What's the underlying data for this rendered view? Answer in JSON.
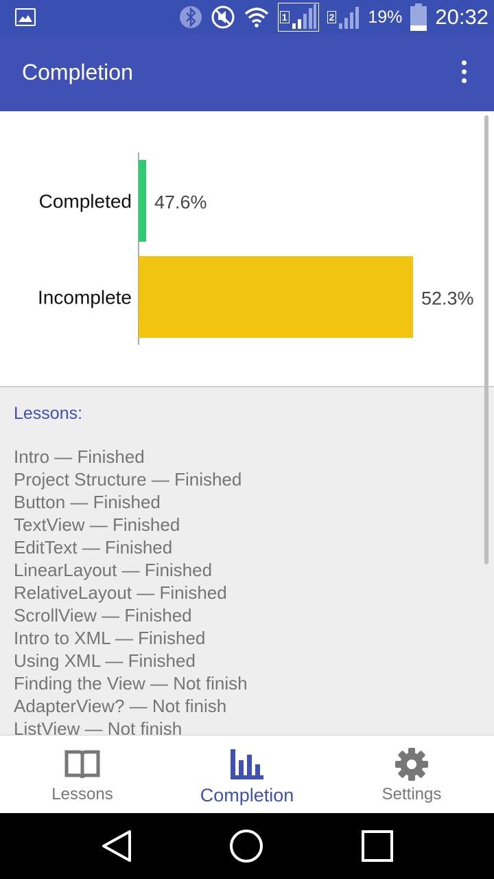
{
  "status_bar": {
    "battery": "19%",
    "time": "20:32",
    "sim1": "1",
    "sim2": "2",
    "icons": [
      "image-icon",
      "bluetooth-icon",
      "mute-icon",
      "wifi-icon",
      "signal-sim1-icon",
      "signal-sim2-icon",
      "battery-icon"
    ]
  },
  "app_bar": {
    "title": "Completion",
    "menu_icon": "more-vert-icon"
  },
  "chart_data": {
    "type": "bar",
    "orientation": "horizontal",
    "categories": [
      "Completed",
      "Incomplete"
    ],
    "values": [
      47.6,
      52.3
    ],
    "value_labels": [
      "47.6%",
      "52.3%"
    ],
    "colors": [
      "#2ecc71",
      "#f1c40f"
    ],
    "title": "",
    "xlabel": "",
    "ylabel": "",
    "grid": false,
    "legend": false
  },
  "lessons": {
    "heading": "Lessons:",
    "items": [
      "Intro — Finished",
      "Project Structure — Finished",
      "Button — Finished",
      "TextView — Finished",
      "EditText — Finished",
      "LinearLayout — Finished",
      "RelativeLayout — Finished",
      "ScrollView — Finished",
      "Intro to XML — Finished",
      "Using XML — Finished",
      "Finding the View — Not finish",
      "AdapterView? — Not finish",
      "ListView — Not finish"
    ]
  },
  "bottom_nav": {
    "items": [
      {
        "label": "Lessons",
        "icon": "book-icon",
        "active": false
      },
      {
        "label": "Completion",
        "icon": "bar-chart-icon",
        "active": true
      },
      {
        "label": "Settings",
        "icon": "gear-icon",
        "active": false
      }
    ]
  },
  "system_nav": {
    "icons": [
      "back-icon",
      "home-icon",
      "recents-icon"
    ]
  },
  "colors": {
    "primary": "#3f51b5",
    "status_bar": "#3a4fb2",
    "accent_active": "#3f51b5",
    "inactive": "#777777"
  }
}
